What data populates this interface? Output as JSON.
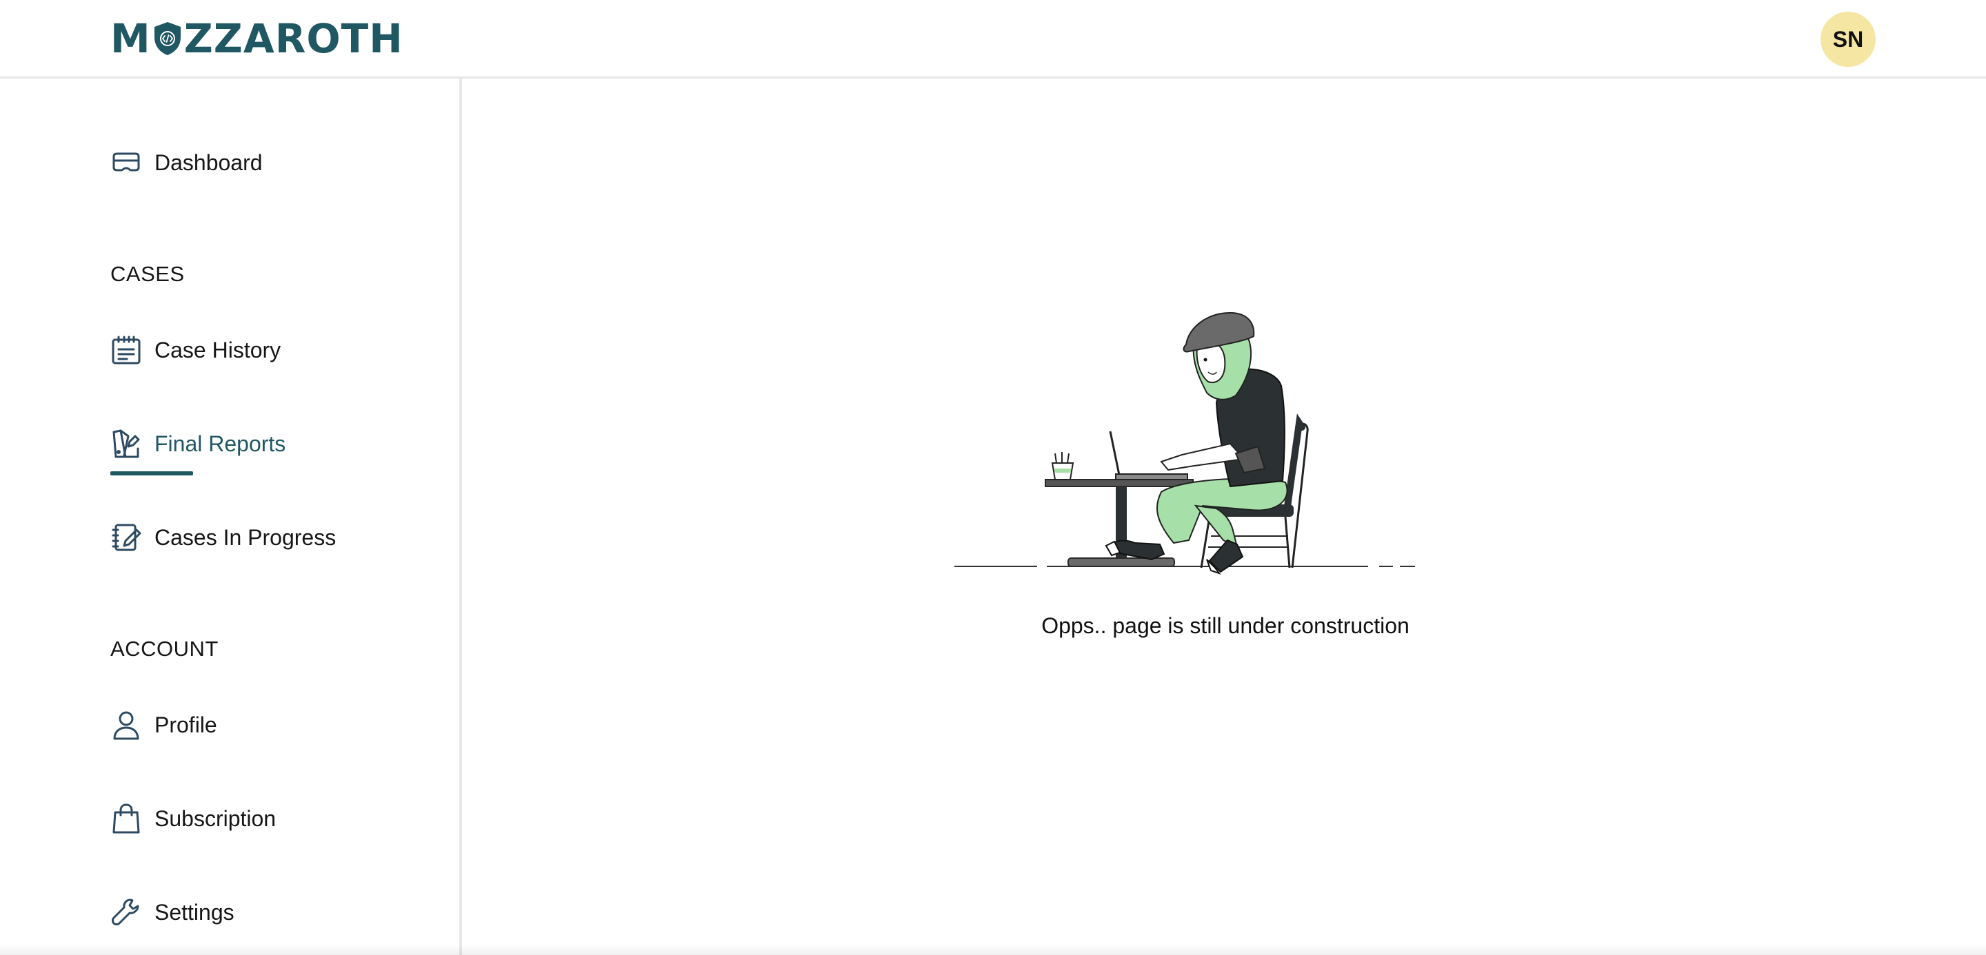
{
  "header": {
    "logo": {
      "part1": "M",
      "part2": "ZZAROTH",
      "brand_color": "#1f5763"
    },
    "avatar_initials": "SN",
    "avatar_color": "#f5e6a4"
  },
  "sidebar": {
    "dashboard": {
      "label": "Dashboard",
      "icon": "dashboard-icon"
    },
    "cases_title": "CASES",
    "case_history": {
      "label": "Case History",
      "icon": "calendar-list-icon"
    },
    "final_reports": {
      "label": "Final Reports",
      "icon": "report-edit-icon",
      "active": true
    },
    "cases_in_progress": {
      "label": "Cases In Progress",
      "icon": "notebook-edit-icon"
    },
    "account_title": "ACCOUNT",
    "profile": {
      "label": "Profile",
      "icon": "user-icon"
    },
    "subscription": {
      "label": "Subscription",
      "icon": "shopping-bag-icon"
    },
    "settings": {
      "label": "Settings",
      "icon": "wrench-icon"
    }
  },
  "main": {
    "message": "Opps.. page is still under construction",
    "illustration": "person-working-on-laptop-illustration"
  }
}
